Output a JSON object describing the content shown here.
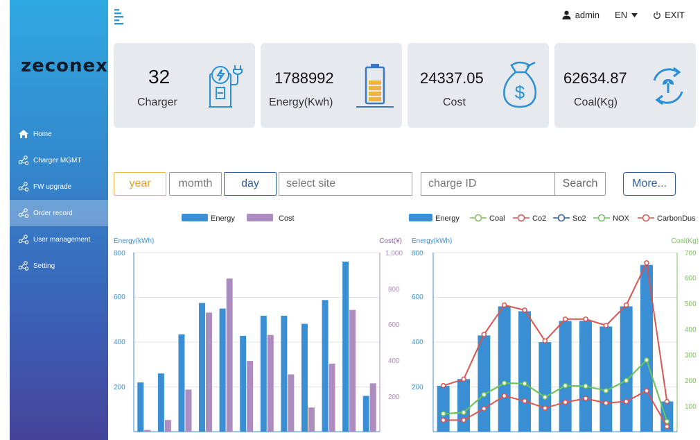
{
  "app": {
    "logo_text": "zeconex"
  },
  "header": {
    "user": "admin",
    "language": "EN",
    "exit_label": "EXIT"
  },
  "sidebar": {
    "items": [
      {
        "label": "Home",
        "icon": "home-icon",
        "active": false
      },
      {
        "label": "Charger MGMT",
        "icon": "share-icon",
        "active": false
      },
      {
        "label": "FW upgrade",
        "icon": "share-icon",
        "active": false
      },
      {
        "label": "Order record",
        "icon": "share-icon",
        "active": true
      },
      {
        "label": "User management",
        "icon": "share-icon",
        "active": false
      },
      {
        "label": "Setting",
        "icon": "share-icon",
        "active": false
      }
    ]
  },
  "stats": [
    {
      "value": "32",
      "label": "Charger",
      "icon": "charger-station-icon"
    },
    {
      "value": "1788992",
      "label": "Energy(Kwh)",
      "icon": "battery-icon"
    },
    {
      "value": "24337.05",
      "label": "Cost",
      "icon": "money-bag-icon"
    },
    {
      "value": "62634.87",
      "label": "Coal(Kg)",
      "icon": "recycle-leaf-icon"
    }
  ],
  "filters": {
    "year_label": "year",
    "month_label": "momth",
    "day_label": "day",
    "site_placeholder": "select site",
    "charge_id_placeholder": "charge ID",
    "search_label": "Search",
    "more_label": "More..."
  },
  "colors": {
    "bar_blue": "#3a8fd4",
    "bar_purple": "#ad8cc0",
    "coal": "#7cbd5a",
    "co2": "#d9534f",
    "so2": "#2b5fa8",
    "nox": "#6cc35a",
    "carbondust": "#e0534f"
  },
  "chart_data": [
    {
      "type": "bar",
      "legend": [
        "Energy",
        "Cost"
      ],
      "ylabel": "Energy(kWh)",
      "y2label": "Cost(¥)",
      "yticks": [
        "200",
        "400",
        "600",
        "800"
      ],
      "y2ticks": [
        "200",
        "400",
        "600",
        "800",
        "1,000"
      ],
      "ylim": [
        0,
        800
      ],
      "y2lim": [
        0,
        1000
      ],
      "series": [
        {
          "name": "Energy",
          "axis": "left",
          "values": [
            220,
            260,
            435,
            575,
            550,
            428,
            518,
            518,
            482,
            588,
            760,
            160
          ]
        },
        {
          "name": "Cost",
          "axis": "right",
          "values": [
            10,
            65,
            235,
            665,
            855,
            395,
            540,
            320,
            135,
            380,
            680,
            270
          ]
        }
      ]
    },
    {
      "type": "bar",
      "legend": [
        "Energy",
        "Coal",
        "Co2",
        "So2",
        "NOX",
        "CarbonDus"
      ],
      "ylabel": "Energy(kWh)",
      "y2label": "Coal(Kg)",
      "yticks": [
        "200",
        "400",
        "600",
        "800"
      ],
      "y2ticks": [
        "100",
        "200",
        "300",
        "400",
        "500",
        "600",
        "700"
      ],
      "ylim": [
        0,
        800
      ],
      "y2lim": [
        0,
        700
      ],
      "series": [
        {
          "name": "Energy",
          "axis": "left",
          "values": [
            205,
            235,
            430,
            560,
            538,
            400,
            495,
            495,
            470,
            560,
            745,
            135
          ]
        },
        {
          "name": "Coal",
          "axis": "right",
          "values": [
            70,
            75,
            145,
            190,
            188,
            135,
            180,
            178,
            160,
            200,
            280,
            40
          ]
        },
        {
          "name": "Co2",
          "axis": "right",
          "values": [
            180,
            205,
            380,
            495,
            475,
            355,
            440,
            440,
            415,
            495,
            660,
            118
          ]
        },
        {
          "name": "NOX",
          "axis": "right",
          "values": [
            70,
            75,
            145,
            190,
            188,
            135,
            180,
            178,
            160,
            200,
            280,
            40
          ]
        },
        {
          "name": "CarbonDus",
          "axis": "right",
          "values": [
            45,
            45,
            90,
            140,
            120,
            92,
            115,
            130,
            112,
            118,
            160,
            20
          ]
        }
      ]
    }
  ]
}
